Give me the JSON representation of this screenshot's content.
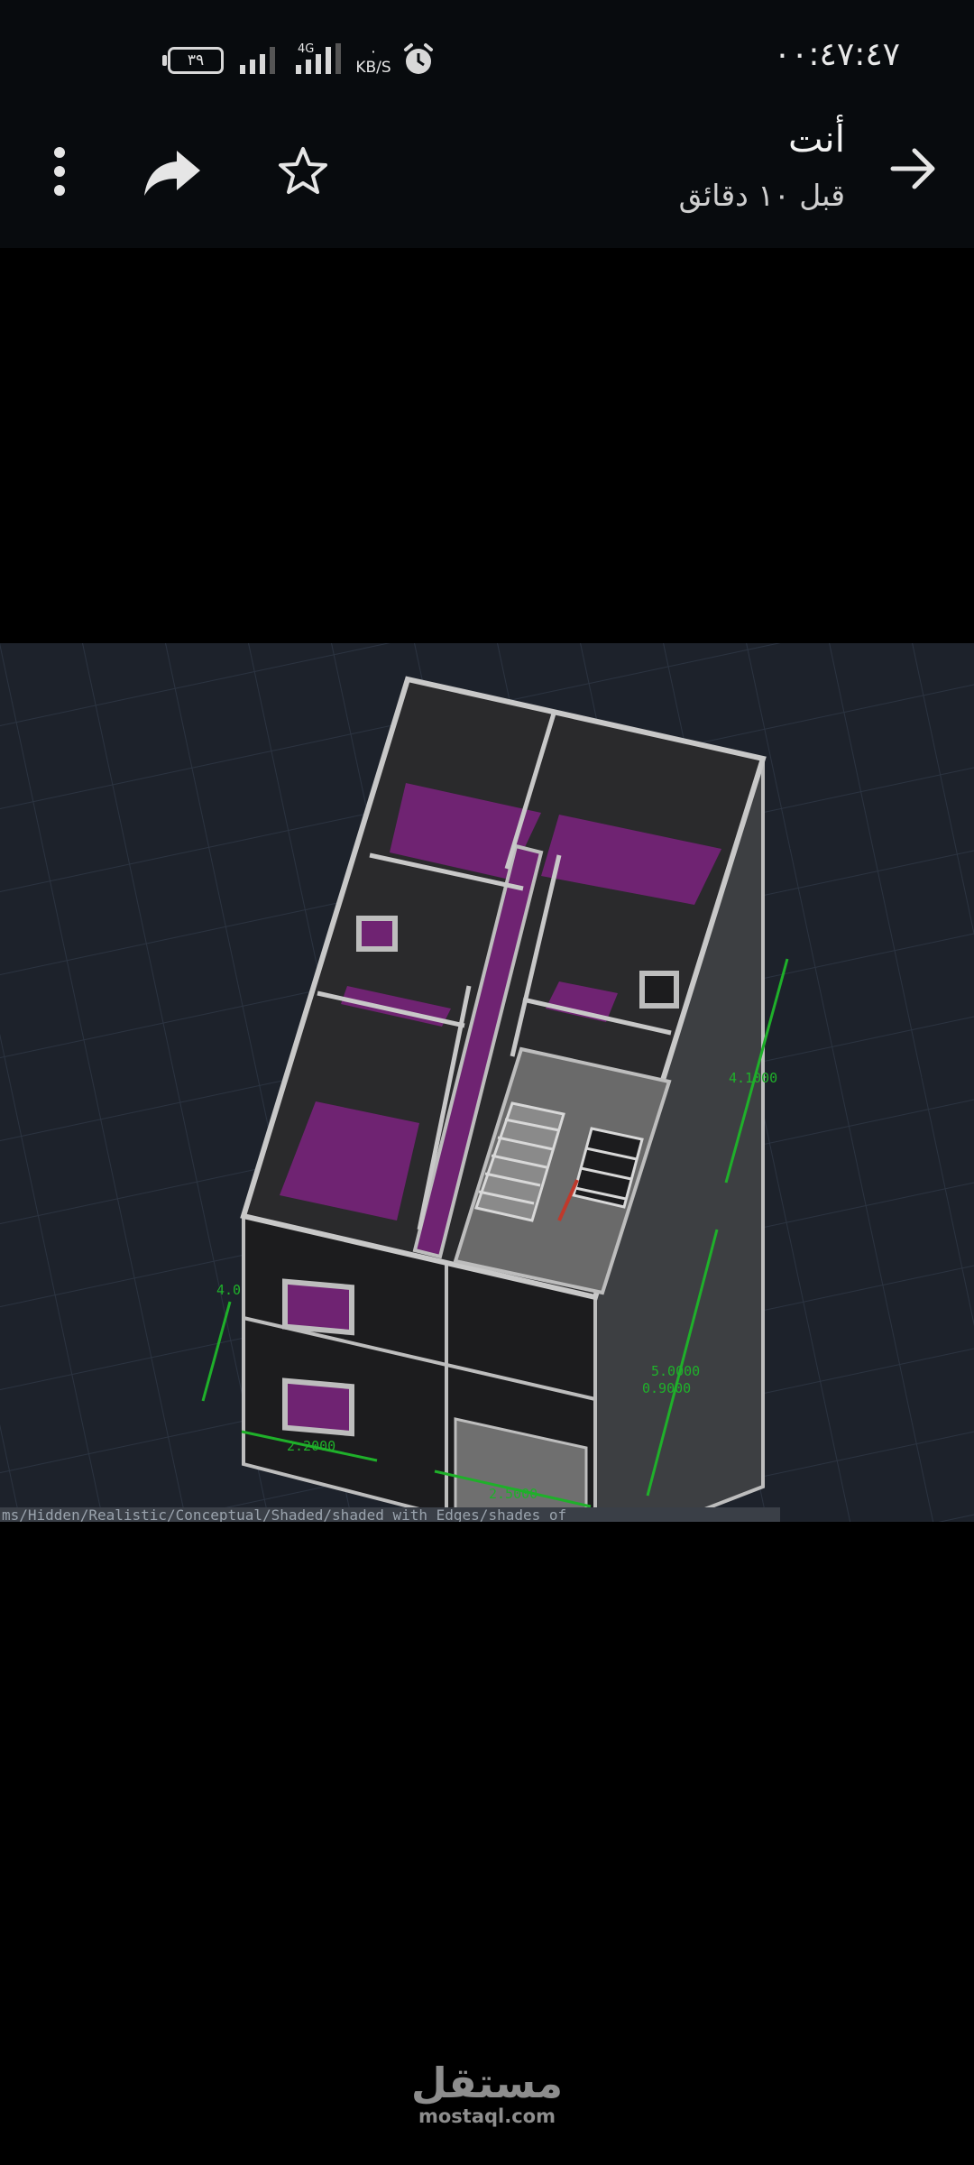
{
  "status_bar": {
    "time": "٠٠:٤٧:٤٧",
    "battery_level": "٣٩",
    "network_type": "4G",
    "data_speed_value": "٠",
    "data_speed_unit": "KB/S",
    "icons": [
      "battery-icon",
      "signal-icon",
      "signal-4g-icon",
      "alarm-icon"
    ]
  },
  "toolbar": {
    "sender": "أنت",
    "timestamp": "قبل ١٠ دقائق",
    "icons": [
      "back-arrow-icon",
      "star-icon",
      "share-icon",
      "more-vertical-icon"
    ]
  },
  "image": {
    "dimensions": [
      "4.1000",
      "4.0",
      "5.0000",
      "0.9000",
      "2.2000",
      "2.5000"
    ],
    "command_line": "ms/Hidden/Realistic/Conceptual/Shaded/shaded with Edges/shades of",
    "colors": {
      "viewport": "#1d222b",
      "grid": "#2b3340",
      "floor": "#6f2372",
      "dimension": "#1fb02a"
    }
  },
  "watermark": {
    "brand": "مستقل",
    "url": "mostaql.com"
  }
}
